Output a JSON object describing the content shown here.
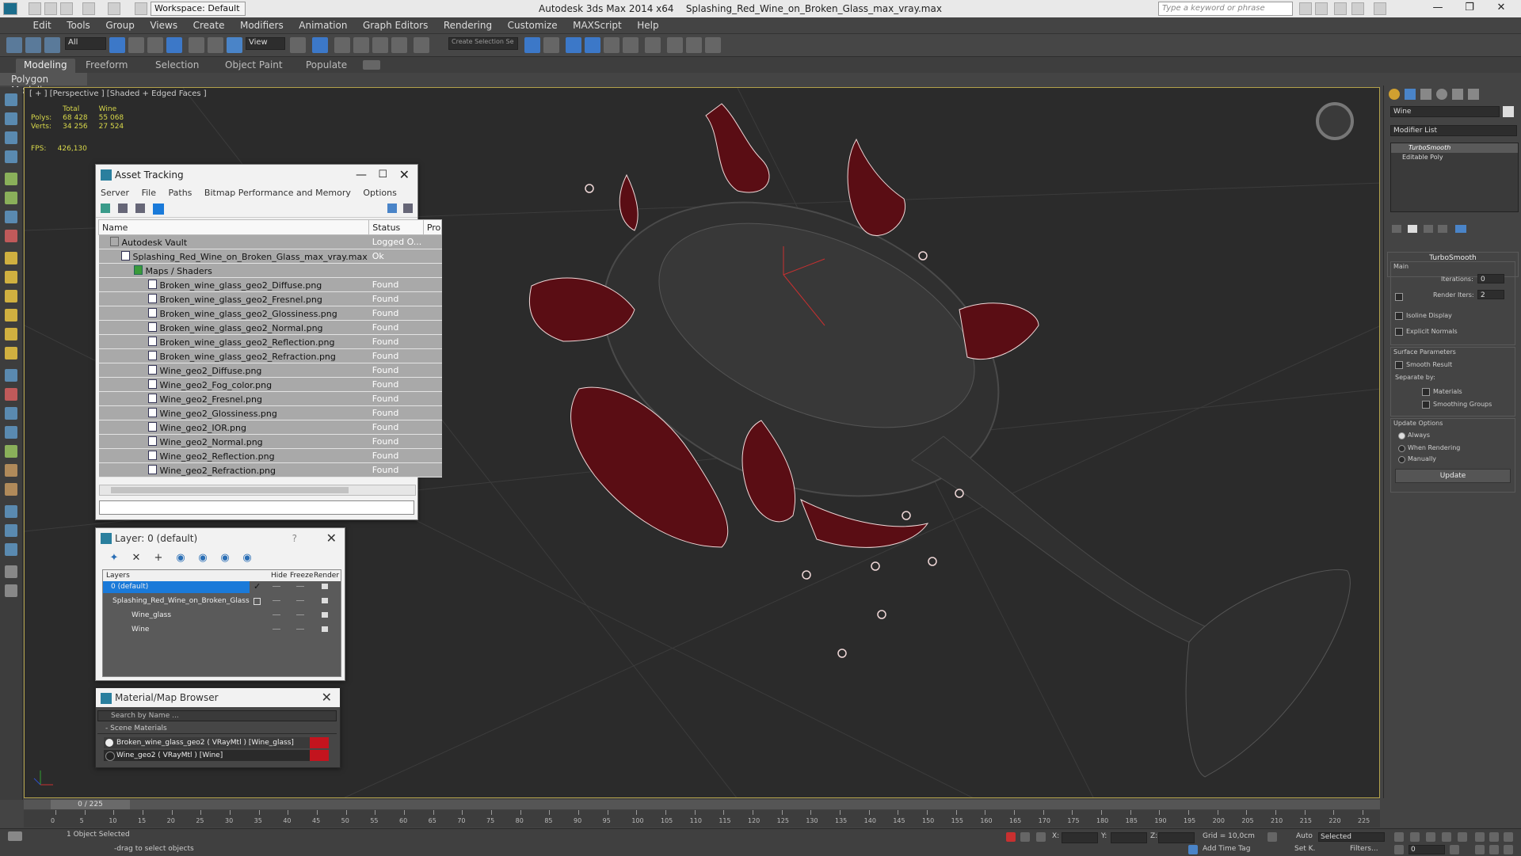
{
  "titlebar": {
    "workspace": "Workspace: Default",
    "app_title": "Autodesk 3ds Max  2014 x64",
    "file_title": "Splashing_Red_Wine_on_Broken_Glass_max_vray.max",
    "search_placeholder": "Type a keyword or phrase"
  },
  "menu": [
    "Edit",
    "Tools",
    "Group",
    "Views",
    "Create",
    "Modifiers",
    "Animation",
    "Graph Editors",
    "Rendering",
    "Customize",
    "MAXScript",
    "Help"
  ],
  "toolbar": {
    "filter_value": "All",
    "refcoord_value": "View",
    "selection_set_placeholder": "Create Selection Se"
  },
  "ribbon": {
    "tabs": [
      "Modeling",
      "Freeform",
      "Selection",
      "Object Paint",
      "Populate"
    ],
    "sub_label": "Polygon Modeling"
  },
  "viewport": {
    "label": "[ + ] [Perspective ] [Shaded + Edged Faces ]",
    "stats": {
      "col_total": "Total",
      "col_wine": "Wine",
      "polys_label": "Polys:",
      "polys_total": "68 428",
      "polys_wine": "55 068",
      "verts_label": "Verts:",
      "verts_total": "34 256",
      "verts_wine": "27 524",
      "fps_label": "FPS:",
      "fps_value": "426,130"
    }
  },
  "asset_tracking": {
    "title": "Asset Tracking",
    "menu": [
      "Server",
      "File",
      "Paths",
      "Bitmap Performance and Memory",
      "Options"
    ],
    "headers": [
      "Name",
      "Status",
      "Pro"
    ],
    "rows": [
      {
        "name": "Autodesk Vault",
        "status": "Logged O..."
      },
      {
        "name": "Splashing_Red_Wine_on_Broken_Glass_max_vray.max",
        "status": "Ok"
      },
      {
        "name": "Maps / Shaders",
        "status": ""
      },
      {
        "name": "Broken_wine_glass_geo2_Diffuse.png",
        "status": "Found"
      },
      {
        "name": "Broken_wine_glass_geo2_Fresnel.png",
        "status": "Found"
      },
      {
        "name": "Broken_wine_glass_geo2_Glossiness.png",
        "status": "Found"
      },
      {
        "name": "Broken_wine_glass_geo2_Normal.png",
        "status": "Found"
      },
      {
        "name": "Broken_wine_glass_geo2_Reflection.png",
        "status": "Found"
      },
      {
        "name": "Broken_wine_glass_geo2_Refraction.png",
        "status": "Found"
      },
      {
        "name": "Wine_geo2_Diffuse.png",
        "status": "Found"
      },
      {
        "name": "Wine_geo2_Fog_color.png",
        "status": "Found"
      },
      {
        "name": "Wine_geo2_Fresnel.png",
        "status": "Found"
      },
      {
        "name": "Wine_geo2_Glossiness.png",
        "status": "Found"
      },
      {
        "name": "Wine_geo2_IOR.png",
        "status": "Found"
      },
      {
        "name": "Wine_geo2_Normal.png",
        "status": "Found"
      },
      {
        "name": "Wine_geo2_Reflection.png",
        "status": "Found"
      },
      {
        "name": "Wine_geo2_Refraction.png",
        "status": "Found"
      }
    ]
  },
  "layer_manager": {
    "title": "Layer: 0 (default)",
    "help": "?",
    "headers": [
      "Layers",
      "Hide",
      "Freeze",
      "Render"
    ],
    "rows": [
      {
        "name": "0 (default)"
      },
      {
        "name": "Splashing_Red_Wine_on_Broken_Glass"
      },
      {
        "name": "Wine_glass"
      },
      {
        "name": "Wine"
      }
    ]
  },
  "material_browser": {
    "title": "Material/Map Browser",
    "search_placeholder": "Search by Name ...",
    "group": "- Scene Materials",
    "items": [
      {
        "name": "Broken_wine_glass_geo2 ( VRayMtl ) [Wine_glass]"
      },
      {
        "name": "Wine_geo2 ( VRayMtl ) [Wine]"
      }
    ]
  },
  "command_panel": {
    "object_name": "Wine",
    "modifier_list": "Modifier List",
    "stack": [
      "TurboSmooth",
      "Editable Poly"
    ],
    "rollout_title": "TurboSmooth",
    "main_label": "Main",
    "iterations_label": "Iterations:",
    "iterations_value": "0",
    "render_iters_label": "Render Iters:",
    "render_iters_value": "2",
    "isoline_label": "Isoline Display",
    "explicit_normals_label": "Explicit Normals",
    "surface_params_label": "Surface Parameters",
    "smooth_result_label": "Smooth Result",
    "separate_by_label": "Separate by:",
    "materials_label": "Materials",
    "smoothing_groups_label": "Smoothing Groups",
    "update_options_label": "Update Options",
    "always_label": "Always",
    "when_rendering_label": "When Rendering",
    "manually_label": "Manually",
    "update_button": "Update"
  },
  "timeline": {
    "frame_indicator": "0 / 225",
    "tick_labels": [
      "0",
      "5",
      "10",
      "15",
      "20",
      "25",
      "30",
      "35",
      "40",
      "45",
      "50",
      "55",
      "60",
      "65",
      "70",
      "75",
      "80",
      "85",
      "90",
      "95",
      "100",
      "105",
      "110",
      "115",
      "120",
      "125",
      "130",
      "135",
      "140",
      "145",
      "150",
      "155",
      "160",
      "165",
      "170",
      "175",
      "180",
      "185",
      "190",
      "195",
      "200",
      "205",
      "210",
      "215",
      "220",
      "225"
    ]
  },
  "statusbar": {
    "selected_text": "1 Object Selected",
    "prompt_text": "-drag to select objects",
    "x_label": "X:",
    "y_label": "Y:",
    "z_label": "Z:",
    "grid_text": "Grid = 10,0cm",
    "auto_label": "Auto",
    "selected_dropdown": "Selected",
    "setk_label": "Set K.",
    "filters_label": "Filters...",
    "add_time_tag": "Add Time Tag",
    "frame_field": "0"
  },
  "colors": {
    "wine_red": "#c3141e",
    "selection_blue": "#1a7ad9",
    "viewport_border": "#b3a24b",
    "stats_yellow": "#d8d84a"
  }
}
